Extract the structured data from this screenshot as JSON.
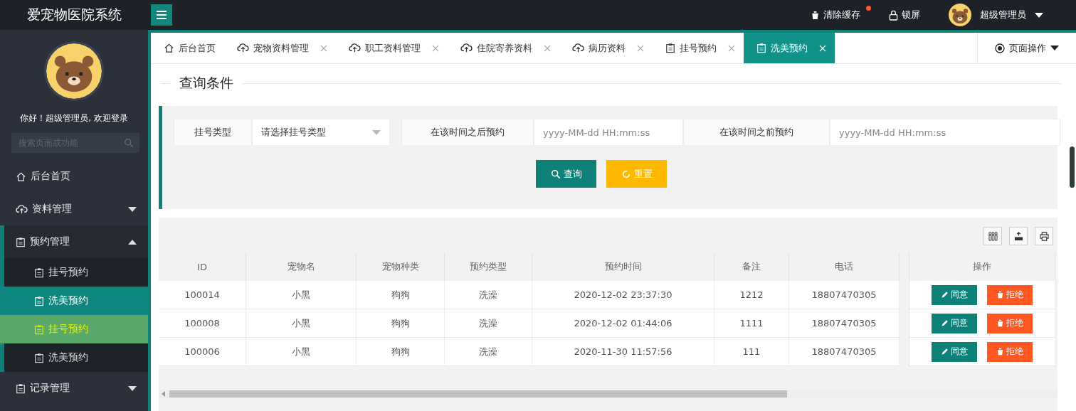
{
  "header": {
    "title": "爱宠物医院系统",
    "actions": [
      {
        "kind": "trash",
        "label": "清除缓存",
        "badge": true
      },
      {
        "kind": "lock",
        "label": "锁屏",
        "badge": false
      }
    ],
    "user": "超级管理员"
  },
  "sidebar": {
    "greeting": "你好！超级管理员, 欢迎登录",
    "search": {
      "placeholder": "搜索页面或功能"
    },
    "items": [
      {
        "label": "后台首页",
        "kind": "home"
      },
      {
        "label": "资料管理",
        "kind": "cloud",
        "expanded": false
      },
      {
        "label": "预约管理",
        "kind": "clipboard",
        "expanded": true,
        "children": [
          {
            "label": "挂号预约",
            "selected": false,
            "hovered": false
          },
          {
            "label": "洗美预约",
            "selected": true,
            "hovered": false
          },
          {
            "label": "挂号预约",
            "selected": false,
            "hovered": true
          },
          {
            "label": "洗美预约",
            "selected": false,
            "hovered": false
          }
        ]
      },
      {
        "label": "记录管理",
        "kind": "clipboard",
        "expanded": false
      }
    ]
  },
  "tabs": [
    {
      "label": "后台首页",
      "kind": "home",
      "closable": false,
      "selected": false
    },
    {
      "label": "宠物资料管理",
      "kind": "cloud",
      "closable": true,
      "selected": false
    },
    {
      "label": "职工资料管理",
      "kind": "cloud",
      "closable": true,
      "selected": false
    },
    {
      "label": "住院寄养资料",
      "kind": "cloud",
      "closable": true,
      "selected": false
    },
    {
      "label": "病历资料",
      "kind": "cloud",
      "closable": true,
      "selected": false
    },
    {
      "label": "挂号预约",
      "kind": "clipboard",
      "closable": true,
      "selected": false
    },
    {
      "label": "洗美预约",
      "kind": "clipboard",
      "closable": true,
      "selected": true
    }
  ],
  "page_actions": "页面操作",
  "query": {
    "legend": "查询条件",
    "fields": [
      {
        "kind": "select",
        "label": "挂号类型",
        "placeholder": "请选择挂号类型"
      },
      {
        "kind": "text",
        "label": "在该时间之后预约",
        "placeholder": "yyyy-MM-dd HH:mm:ss"
      },
      {
        "kind": "text",
        "label": "在该时间之前预约",
        "placeholder": "yyyy-MM-dd HH:mm:ss"
      }
    ],
    "buttons": [
      {
        "kind": "search",
        "label": "查询"
      },
      {
        "kind": "reset",
        "label": "重置"
      }
    ]
  },
  "table": {
    "columns": [
      "ID",
      "宠物名",
      "宠物种类",
      "预约类型",
      "预约时间",
      "备注",
      "电话"
    ],
    "action_column": "操作",
    "rows": [
      {
        "cells": [
          "100014",
          "小黑",
          "狗狗",
          "洗澡",
          "2020-12-02 23:37:30",
          "1212",
          "18807470305"
        ],
        "actions": [
          {
            "kind": "approve",
            "label": "同意"
          },
          {
            "kind": "reject",
            "label": "拒绝"
          }
        ]
      },
      {
        "cells": [
          "100008",
          "小黑",
          "狗狗",
          "洗澡",
          "2020-12-02 01:44:06",
          "1111",
          "18807470305"
        ],
        "actions": [
          {
            "kind": "approve",
            "label": "同意"
          },
          {
            "kind": "reject",
            "label": "拒绝"
          }
        ]
      },
      {
        "cells": [
          "100006",
          "小黑",
          "狗狗",
          "洗澡",
          "2020-11-30 11:57:56",
          "111",
          "18807470305"
        ],
        "actions": [
          {
            "kind": "approve",
            "label": "同意"
          },
          {
            "kind": "reject",
            "label": "拒绝"
          }
        ]
      }
    ]
  }
}
